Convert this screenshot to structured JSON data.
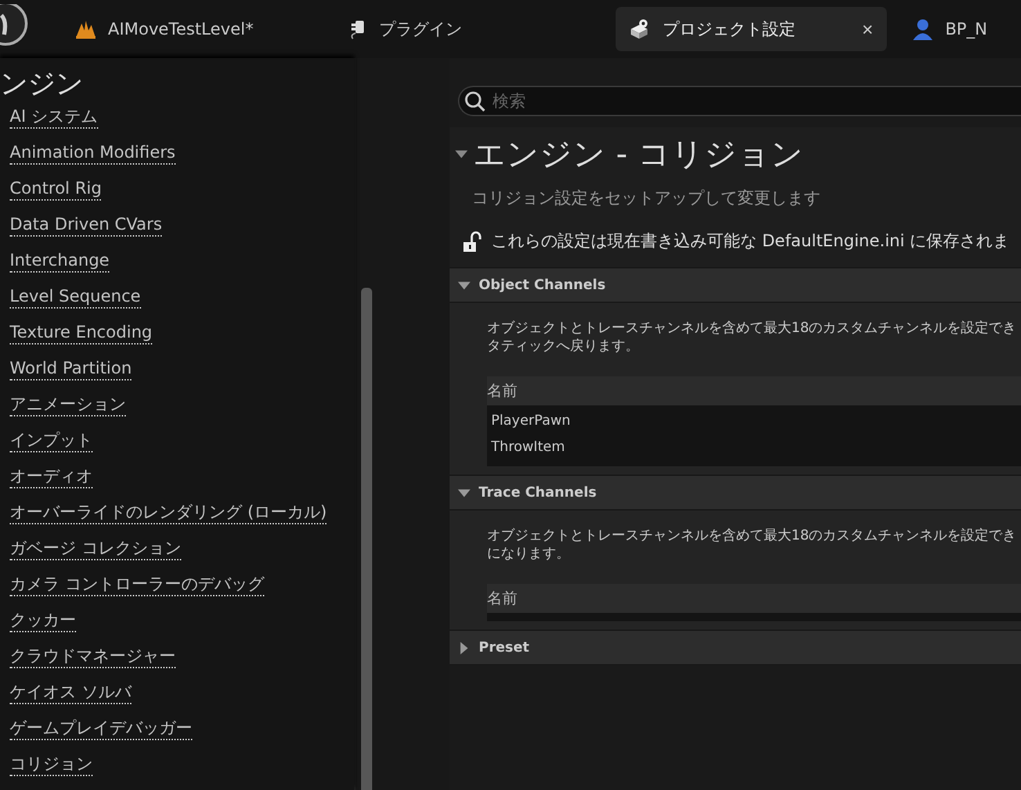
{
  "tabs": [
    {
      "label": "AIMoveTestLevel*",
      "selected": false
    },
    {
      "label": "プラグイン",
      "selected": false
    },
    {
      "label": "プロジェクト設定",
      "selected": true,
      "close": "×"
    },
    {
      "label": "BP_N",
      "selected": false
    }
  ],
  "sidebar": {
    "heading": "ンジン",
    "items": [
      {
        "label": "AI システム"
      },
      {
        "label": "Animation Modifiers"
      },
      {
        "label": "Control Rig"
      },
      {
        "label": "Data Driven CVars"
      },
      {
        "label": "Interchange"
      },
      {
        "label": "Level Sequence"
      },
      {
        "label": "Texture Encoding"
      },
      {
        "label": "World Partition"
      },
      {
        "label": "アニメーション"
      },
      {
        "label": "インプット"
      },
      {
        "label": "オーディオ"
      },
      {
        "label": "オーバーライドのレンダリング (ローカル)"
      },
      {
        "label": "ガベージ コレクション"
      },
      {
        "label": "カメラ コントローラーのデバッグ"
      },
      {
        "label": "クッカー"
      },
      {
        "label": "クラウドマネージャー"
      },
      {
        "label": "ケイオス ソルバ"
      },
      {
        "label": "ゲームプレイデバッガー"
      },
      {
        "label": "コリジョン"
      }
    ]
  },
  "search": {
    "placeholder": "検索"
  },
  "page": {
    "title": "エンジン - コリジョン",
    "description": "コリジョン設定をセットアップして変更します",
    "notice": "これらの設定は現在書き込み可能な DefaultEngine.ini に保存されま"
  },
  "sections": [
    {
      "title": "Object Channels",
      "expanded": true,
      "text": [
        "オブジェクトとトレースチャンネルを含めて最大18のカスタムチャンネルを設定でき",
        "タティックへ戻ります。"
      ],
      "column": "名前",
      "rows": [
        "PlayerPawn",
        "ThrowItem"
      ]
    },
    {
      "title": "Trace Channels",
      "expanded": true,
      "text": [
        "オブジェクトとトレースチャンネルを含めて最大18のカスタムチャンネルを設定でき",
        "になります。"
      ],
      "column": "名前"
    },
    {
      "title": "Preset",
      "expanded": false
    }
  ]
}
